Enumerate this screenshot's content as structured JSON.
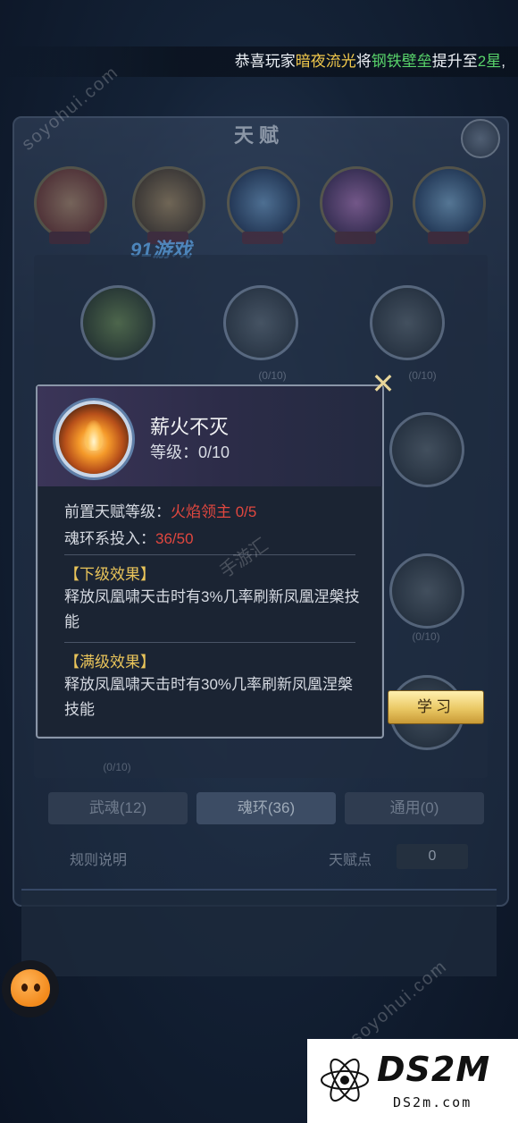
{
  "broadcast": {
    "prefix": "恭喜玩家",
    "player": "暗夜流光",
    "mid": "将",
    "item": "钢铁壁垒",
    "mid2": "提升至",
    "level": "2星",
    "suffix": ","
  },
  "panel": {
    "title": "天赋"
  },
  "popup": {
    "skill_name": "薪火不灭",
    "level_label": "等级：",
    "level_value": "0/10",
    "prereq_label": "前置天赋等级：",
    "prereq_value": "火焰领主 0/5",
    "invest_label": "魂环系投入：",
    "invest_value": "36/50",
    "next_title": "【下级效果】",
    "next_desc": "释放凤凰啸天击时有3%几率刷新凤凰涅槃技能",
    "max_title": "【满级效果】",
    "max_desc": "释放凤凰啸天击时有30%几率刷新凤凰涅槃技能",
    "close_icon": "close-icon"
  },
  "learn_button": "学习",
  "tabs": [
    {
      "label": "武魂(12)"
    },
    {
      "label": "魂环(36)"
    },
    {
      "label": "通用(0)"
    }
  ],
  "footer": {
    "rules": "规则说明",
    "points_label": "天赋点",
    "points_value": "0"
  },
  "tree_labels": [
    "(0/10)",
    "(0/10)",
    "(0/10)",
    "(0/10)"
  ],
  "watermarks": {
    "site_91": "91游戏",
    "soyohui": "soyohui.com",
    "shouyouhui": "手游汇"
  },
  "logo": {
    "main": "DS2M",
    "sub": "DS2m.com"
  },
  "colors": {
    "highlight_yellow": "#f2c94c",
    "highlight_green": "#58d36a",
    "red": "#e0473f",
    "gold": "#e9c45a"
  }
}
